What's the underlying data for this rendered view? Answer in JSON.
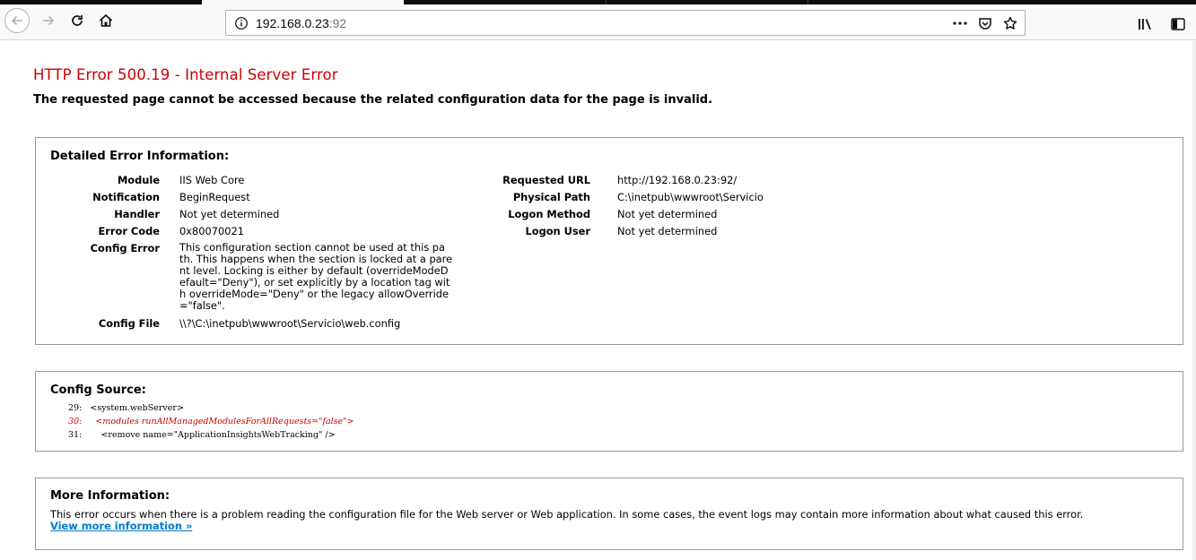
{
  "browser": {
    "url_host": "192.168.0.23",
    "url_port": ":92",
    "icons": {
      "back": "back-arrow-icon",
      "forward": "forward-arrow-icon",
      "reload": "reload-icon",
      "home": "home-icon",
      "site_info": "info-icon",
      "page_actions": "more-dots-icon",
      "pocket": "pocket-icon",
      "bookmark": "star-icon",
      "library": "library-icon",
      "sidebar": "sidebar-icon"
    }
  },
  "error": {
    "title": "HTTP Error 500.19 - Internal Server Error",
    "subtitle": "The requested page cannot be accessed because the related configuration data for the page is invalid."
  },
  "detailed": {
    "heading": "Detailed Error Information:",
    "left": [
      {
        "label": "Module",
        "value": "IIS Web Core"
      },
      {
        "label": "Notification",
        "value": "BeginRequest"
      },
      {
        "label": "Handler",
        "value": "Not yet determined"
      },
      {
        "label": "Error Code",
        "value": "0x80070021"
      }
    ],
    "config_error_label": "Config Error",
    "config_error_lines": [
      "This configuration section cannot be used at this pa",
      "th. This happens when the section is locked at a pare",
      "nt level. Locking is either by default (overrideModeD",
      "efault=\"Deny\"), or set explicitly by a location tag wit",
      "h overrideMode=\"Deny\" or the legacy allowOverride",
      "=\"false\"."
    ],
    "config_file_label": "Config File",
    "config_file_value": "\\\\?\\C:\\inetpub\\wwwroot\\Servicio\\web.config",
    "right": [
      {
        "label": "Requested URL",
        "value": "http://192.168.0.23:92/"
      },
      {
        "label": "Physical Path",
        "value": "C:\\inetpub\\wwwroot\\Servicio"
      },
      {
        "label": "Logon Method",
        "value": "Not yet determined"
      },
      {
        "label": "Logon User",
        "value": "Not yet determined"
      }
    ]
  },
  "config_source": {
    "heading": "Config Source:",
    "lines": [
      {
        "num": "29:",
        "code": "<system.webServer>",
        "highlight": false
      },
      {
        "num": "30:",
        "code": "  <modules runAllManagedModulesForAllRequests=\"false\">",
        "highlight": true
      },
      {
        "num": "31:",
        "code": "    <remove name=\"ApplicationInsightsWebTracking\" />",
        "highlight": false
      }
    ]
  },
  "more_info": {
    "heading": "More Information:",
    "text": "This error occurs when there is a problem reading the configuration file for the Web server or Web application. In some cases, the event logs may contain more information about what caused this error.",
    "link": "View more information »"
  }
}
